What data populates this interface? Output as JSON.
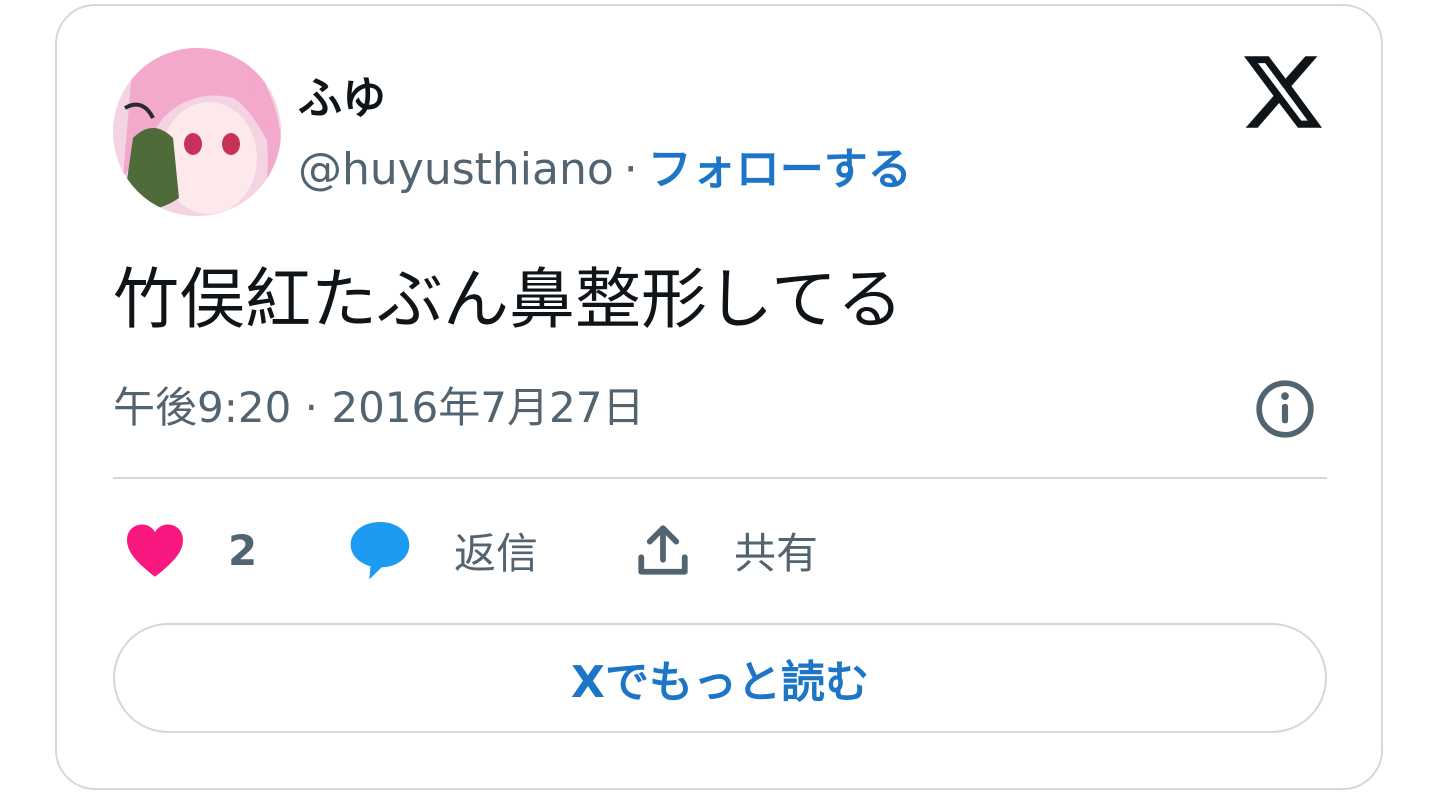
{
  "user": {
    "display_name": "ふゆ",
    "handle": "@huyusthiano",
    "separator": "·",
    "follow_label": "フォローする"
  },
  "tweet": {
    "text": "竹俣紅たぶん鼻整形してる",
    "timestamp": "午後9:20 · 2016年7月27日"
  },
  "actions": {
    "like_count": "2",
    "reply_label": "返信",
    "share_label": "共有"
  },
  "read_more_label": "Xでもっと読む",
  "colors": {
    "link": "#1d75c8",
    "muted": "#536471",
    "border": "#cfd9de",
    "like": "#f91880",
    "reply": "#1d9bf0",
    "text": "#0f1419"
  },
  "icons": {
    "brand": "x-logo-icon",
    "info": "info-icon",
    "like": "heart-icon",
    "reply": "speech-bubble-icon",
    "share": "share-upload-icon"
  }
}
